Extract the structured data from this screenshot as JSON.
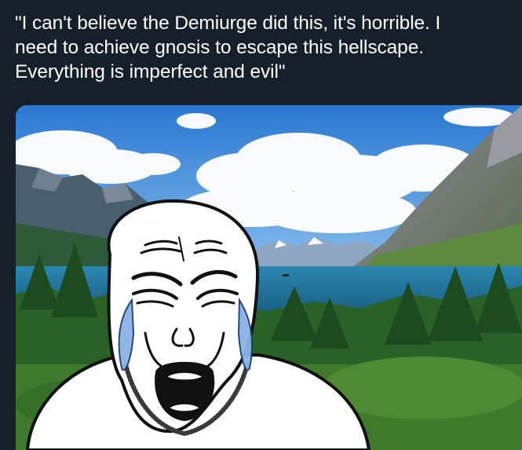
{
  "post": {
    "text": "\"I can't believe the Demiurge did this, it's horrible. I\nneed to achieve gnosis to escape this hellscape.\nEverything is imperfect and evil\""
  },
  "media": {
    "scene": "mountain-lake-landscape",
    "overlay": "crying-wojak-face"
  },
  "colors": {
    "background": "#15202b",
    "text": "#ffffff",
    "sky": "#2f7fd6",
    "lake": "#1f6f9a",
    "forest": "#2d6a2a",
    "tears": "#8ab3e6"
  }
}
